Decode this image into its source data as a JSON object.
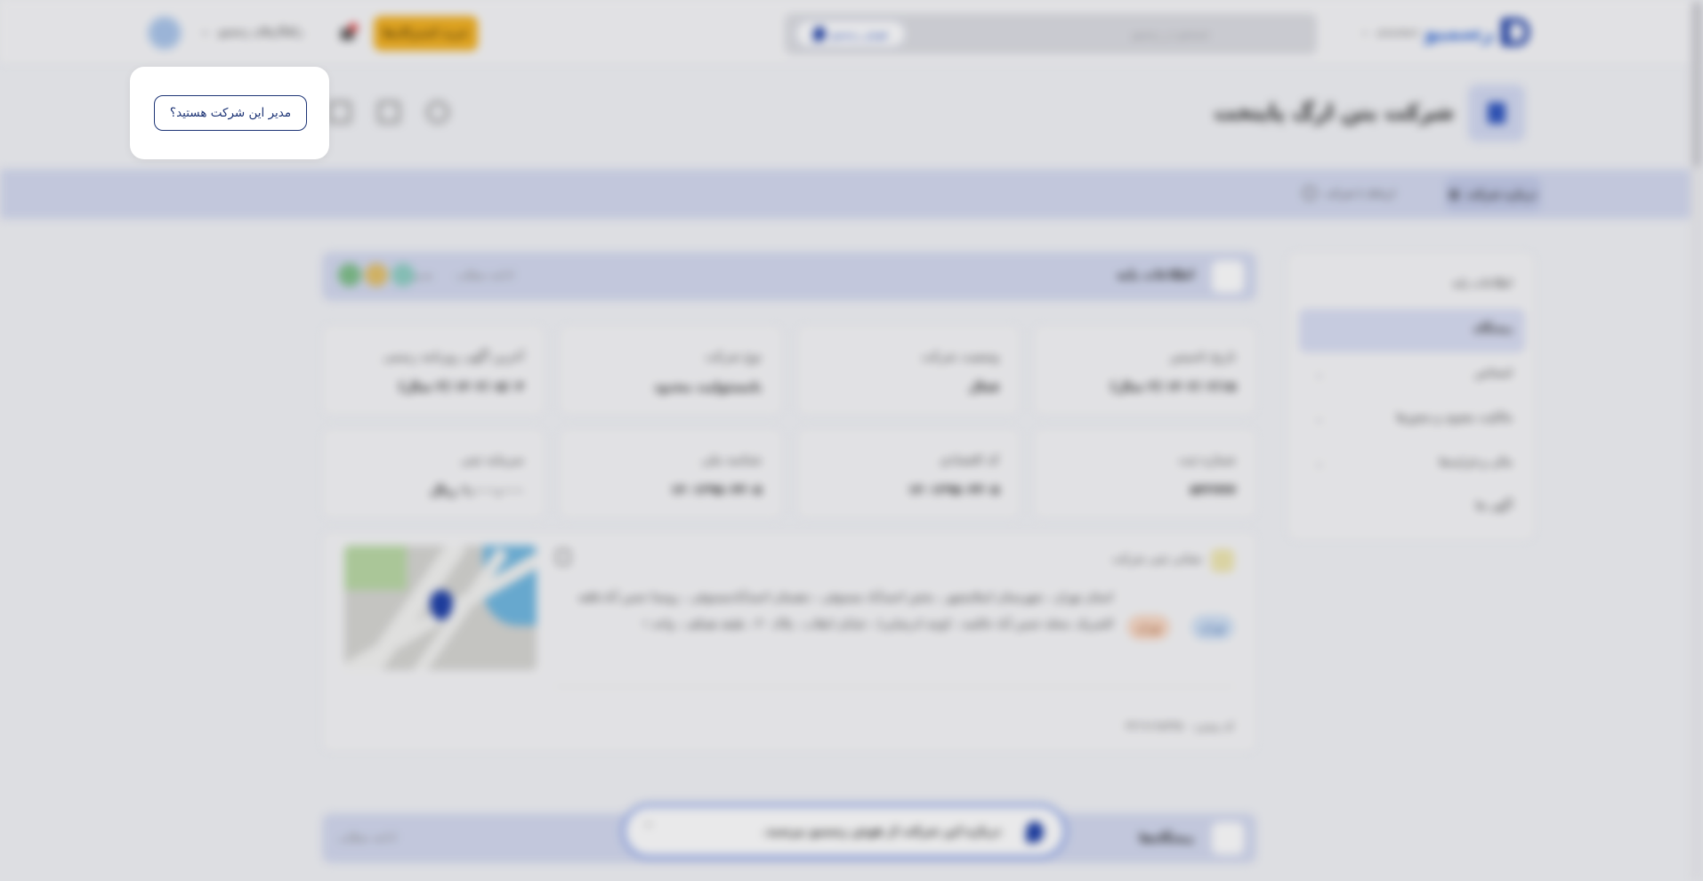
{
  "header": {
    "logo_text": "رسمیو",
    "nav_menu_label": "دسته‌بندی",
    "search_placeholder": "جستجو در رسمیو",
    "ai_pill_label": "هوش رسمیو",
    "buy_button_label": "خرید اشتراک‌ها",
    "solutions_label": "راهکارهای رسمیو"
  },
  "company": {
    "title": "شرکت بتن ارگ پایتخت"
  },
  "tabs": {
    "active_label": "درباره شرکت",
    "second_label": "ارتباط با شرکت"
  },
  "sidebar": {
    "items": [
      {
        "label": "اطلاعات پایه",
        "has_chevron": false
      },
      {
        "label": "پیشگاه",
        "has_chevron": false
      },
      {
        "label": "اشخاص",
        "has_chevron": true
      },
      {
        "label": "مالکیت معنوی و مجوزها",
        "has_chevron": true
      },
      {
        "label": "مالی و فرایندها",
        "has_chevron": true
      },
      {
        "label": "آگهی ها",
        "has_chevron": false
      }
    ],
    "chevron": "⌄"
  },
  "section_basic": {
    "title": "اطلاعات پایه",
    "more_label": "ادامه‌ مطلب",
    "extra_label": "مدیر"
  },
  "cards": [
    {
      "label": "تاریخ تاسیس",
      "value": "۱۴۰۲/۰۲/۱۵ (۲ سال)"
    },
    {
      "label": "وضعیت شرکت",
      "value": "فعال"
    },
    {
      "label": "نوع شرکت",
      "value": "بامسئولیت محدود"
    },
    {
      "label": "آخرین آگهی روزنامه رسمی",
      "value": "۱۴۰۲/۰۵/۰۴ (۲ سال)"
    },
    {
      "label": "شماره ثبت",
      "value": "۵۴۲۷۷۷"
    },
    {
      "label": "کد اقتصادی",
      "value": "۱۴۰۱۲۹۵۰۴۳۰۵"
    },
    {
      "label": "شناسه ملی",
      "value": "۱۴۰۱۲۹۵۰۴۳۰۵"
    },
    {
      "label": "سرمایه ثبتی",
      "value": "۱,۰۰۰,۰۰۰ ریال"
    }
  ],
  "address": {
    "title": "نشانی ثبتی شرکت",
    "text": "استان تهران ، شهرستان اسلامشهر ، بخش احمدآباد مستوفی ، دهستان احمدآبادمستوفی ، روستا حسن آباد،قلعه الشريک ،محله حسن آباد خالصه ، کوچه ادرضایی) ، خیابان انقلاب ، پلاک ۳۰ ، طبقه همکف ، واحد ۱",
    "tag_province": "تهران",
    "tag_city": "تهران",
    "postal_label": "کد پستی:",
    "postal_value": "۳۳۱۹۱۹۸۴۳۵"
  },
  "section_bottom": {
    "title": "پیشگاه‌ها",
    "more_label": "ادامه‌ مطلب"
  },
  "ai_bar": {
    "text": "درباره این شرکت از هوش رسمیو بپرسید.",
    "chevron": "⌃"
  },
  "popup": {
    "button_label": "مدیر این شرکت هستید؟"
  }
}
